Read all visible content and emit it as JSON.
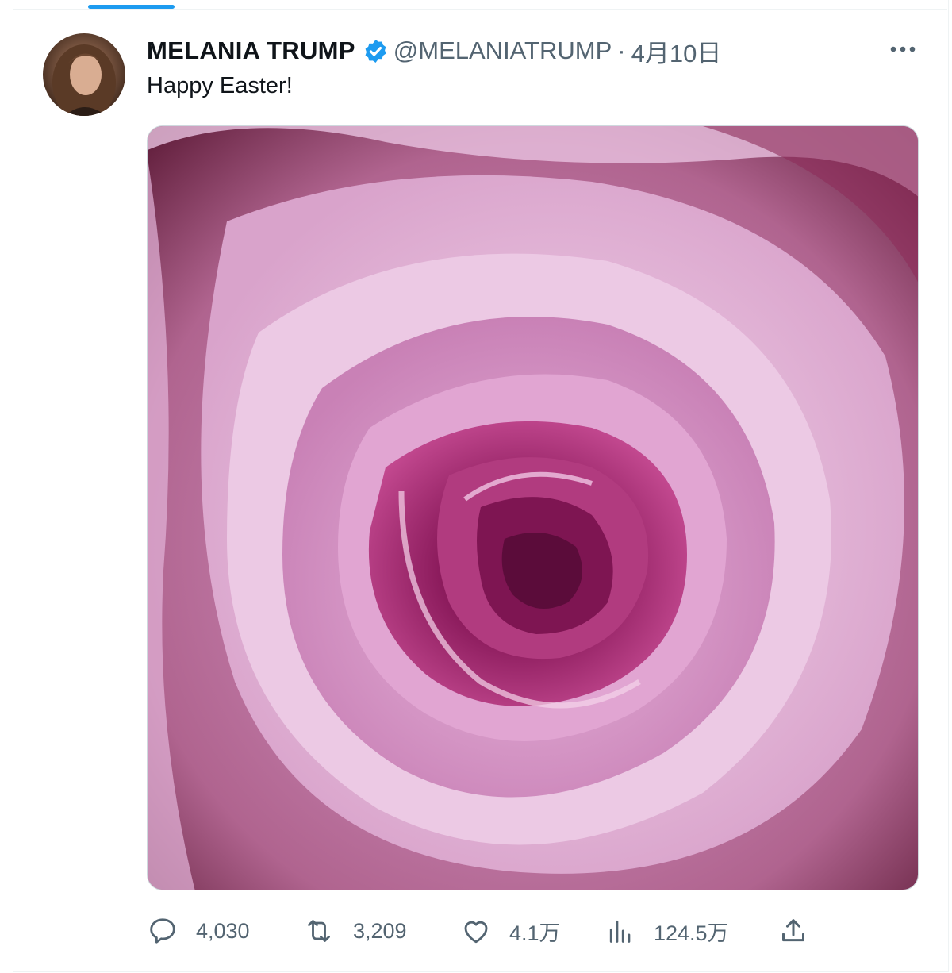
{
  "tweet": {
    "author_name": "MELANIA TRUMP",
    "handle": "@MELANIATRUMP",
    "separator": "·",
    "date": "4月10日",
    "text": "Happy Easter!"
  },
  "actions": {
    "replies": "4,030",
    "retweets": "3,209",
    "likes": "4.1万",
    "views": "124.5万"
  },
  "colors": {
    "accent": "#1d9bf0",
    "text_primary": "#0f1419",
    "text_secondary": "#536471",
    "rose_light": "#e3b3d8",
    "rose_dark": "#7d1450"
  },
  "icons": [
    "verified-badge-icon",
    "more-icon",
    "reply-icon",
    "retweet-icon",
    "like-icon",
    "views-icon",
    "share-icon"
  ]
}
